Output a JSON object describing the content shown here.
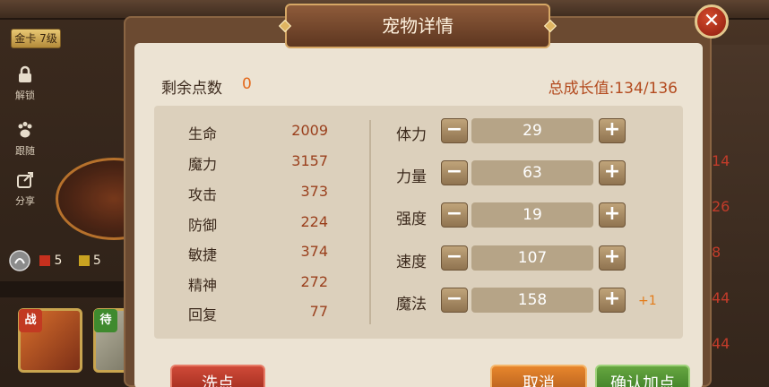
{
  "background": {
    "card_badge": "金卡 7级",
    "side_buttons": [
      {
        "label": "解锁",
        "icon": "lock-icon"
      },
      {
        "label": "跟随",
        "icon": "paw-icon"
      },
      {
        "label": "分享",
        "icon": "share-icon"
      }
    ],
    "counters": {
      "red": "5",
      "yellow": "5"
    },
    "slots": [
      {
        "tag": "战",
        "tag_color": "#c23a22"
      },
      {
        "tag": "待",
        "tag_color": "#3f8a2e"
      }
    ],
    "right_numbers": [
      "14",
      "26",
      "8",
      "44",
      "44"
    ]
  },
  "dialog": {
    "title": "宠物详情",
    "close_symbol": "✕",
    "remaining_points_label": "剩余点数",
    "remaining_points_value": "0",
    "growth_label": "总成长值:134/136",
    "stats": [
      {
        "name": "生命",
        "value": "2009"
      },
      {
        "name": "魔力",
        "value": "3157"
      },
      {
        "name": "攻击",
        "value": "373"
      },
      {
        "name": "防御",
        "value": "224"
      },
      {
        "name": "敏捷",
        "value": "374"
      },
      {
        "name": "精神",
        "value": "272"
      },
      {
        "name": "回复",
        "value": "77"
      }
    ],
    "attributes": [
      {
        "name": "体力",
        "value": "29",
        "bonus": ""
      },
      {
        "name": "力量",
        "value": "63",
        "bonus": ""
      },
      {
        "name": "强度",
        "value": "19",
        "bonus": ""
      },
      {
        "name": "速度",
        "value": "107",
        "bonus": ""
      },
      {
        "name": "魔法",
        "value": "158",
        "bonus": "+1"
      }
    ],
    "minus_symbol": "−",
    "plus_symbol": "+",
    "buttons": {
      "reset": "洗点",
      "cancel": "取消",
      "confirm": "确认加点"
    }
  },
  "colors": {
    "points_value": "#e46a1d",
    "growth": "#b34a1e",
    "stat_value": "#9a3f1c",
    "bonus": "#e37b18"
  }
}
